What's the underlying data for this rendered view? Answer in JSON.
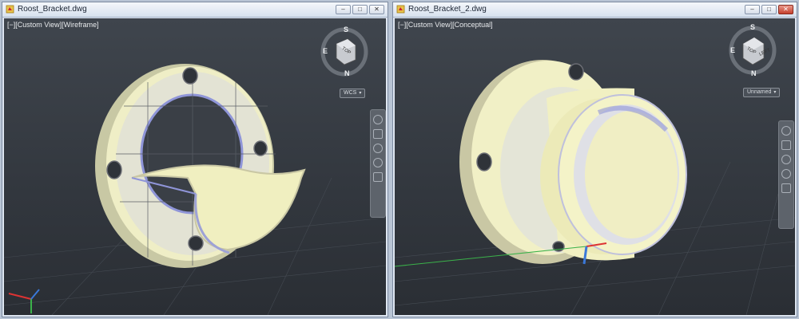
{
  "windows": [
    {
      "title": "Roost_Bracket.dwg",
      "viewport_label": "[−][Custom View][Wireframe]",
      "viewcube": {
        "north": "N",
        "south": "S",
        "east": "E",
        "face": "TOP"
      },
      "ucs_combo": "WCS",
      "buttons": {
        "minimize": "–",
        "restore": "□",
        "close": "✕"
      }
    },
    {
      "title": "Roost_Bracket_2.dwg",
      "viewport_label": "[−][Custom View][Conceptual]",
      "viewcube": {
        "north": "N",
        "south": "S",
        "east": "E",
        "face": "TOP",
        "side": "LEFT"
      },
      "ucs_combo": "Unnamed",
      "buttons": {
        "minimize": "–",
        "restore": "□",
        "close": "✕"
      }
    }
  ],
  "icons": {
    "title": "dwg-file-icon",
    "nav": [
      "steering-wheel-icon",
      "pan-icon",
      "zoom-icon",
      "orbit-icon",
      "showmotion-icon"
    ]
  },
  "colors": {
    "part_fill": "#f3f1c4",
    "part_shade": "#c9c7a4",
    "part_blue": "#8f95d8",
    "viewport_bg": "#373c43"
  }
}
